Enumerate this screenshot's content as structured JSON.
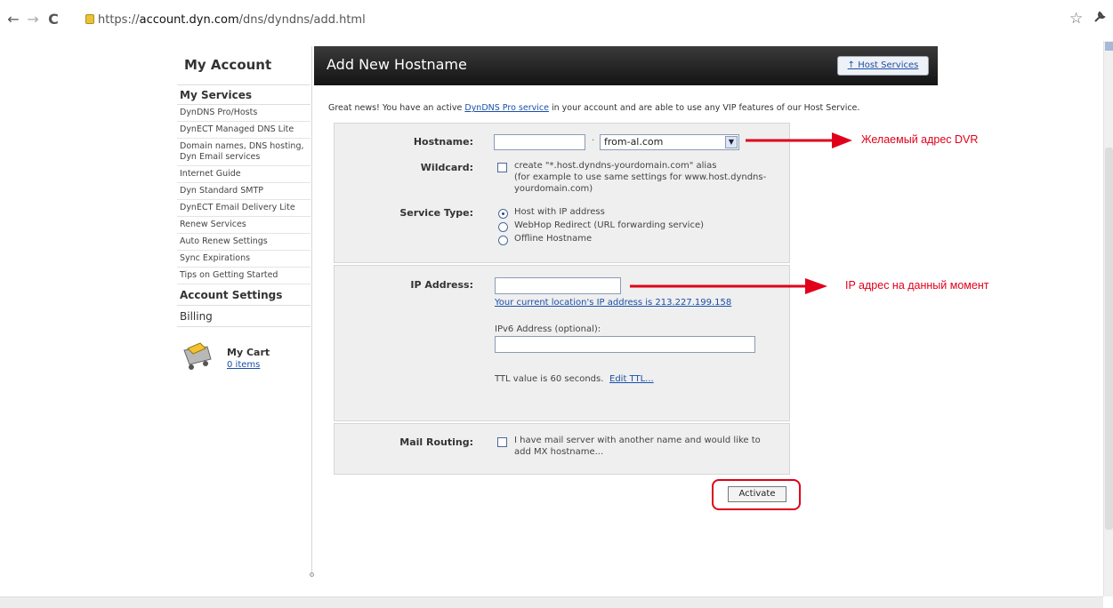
{
  "browser": {
    "url_prefix": "https://",
    "url_host": "account.dyn.com",
    "url_path": "/dns/dyndns/add.html",
    "back_glyph": "←",
    "forward_glyph": "→",
    "reload_glyph": "C",
    "star_glyph": "☆",
    "wrench_glyph": "🔧"
  },
  "sidebar": {
    "title": "My Account",
    "services_header": "My Services",
    "items": [
      "DynDNS Pro/Hosts",
      "DynECT Managed DNS Lite",
      "Domain names, DNS hosting, Dyn Email services",
      "Internet Guide",
      "Dyn Standard SMTP",
      "DynECT Email Delivery Lite",
      "Renew Services",
      "Auto Renew Settings",
      "Sync Expirations",
      "Tips on Getting Started"
    ],
    "account_settings": "Account Settings",
    "billing": "Billing",
    "cart_title": "My Cart",
    "cart_items": "0 items"
  },
  "header": {
    "title": "Add New Hostname",
    "host_services_button": "↑ Host Services"
  },
  "notice": {
    "before": "Great news! You have an active ",
    "link": "DynDNS Pro service",
    "after": " in your account and are able to use any VIP features of our Host Service."
  },
  "form": {
    "hostname_label": "Hostname:",
    "hostname_value": "",
    "domain_selected": "from-al.com",
    "dot": "·",
    "wildcard_label": "Wildcard:",
    "wildcard_text_1": "create \"*.host.dyndns-yourdomain.com\" alias",
    "wildcard_text_2": "(for example to use same settings for www.host.dyndns-",
    "wildcard_text_3": "yourdomain.com)",
    "service_type_label": "Service Type:",
    "service_options": [
      "Host with IP address",
      "WebHop Redirect (URL forwarding service)",
      "Offline Hostname"
    ],
    "service_selected_index": 0,
    "ip_label": "IP Address:",
    "ip_value": "",
    "ip_current_link": "Your current location's IP address is 213.227.199.158",
    "ipv6_label": "IPv6 Address (optional):",
    "ipv6_value": "",
    "ttl_text": "TTL value is 60 seconds.",
    "ttl_link": "Edit TTL...",
    "mail_label": "Mail Routing:",
    "mail_text_1": "I have mail server with another name and would like to",
    "mail_text_2": "add MX hostname...",
    "activate_button": "Activate"
  },
  "annotations": {
    "note_1": "Желаемый адрес DVR",
    "note_2": "IP адрес на данный момент",
    "color": "#e0001a"
  }
}
